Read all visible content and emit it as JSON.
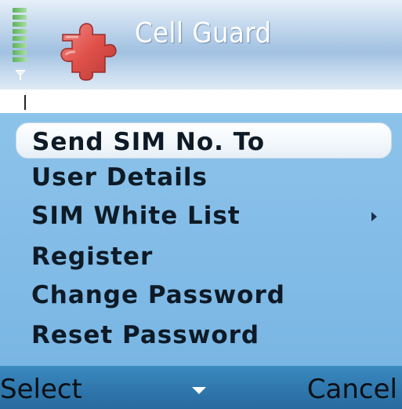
{
  "app": {
    "title": "Cell Guard",
    "icon": "puzzle-piece-icon"
  },
  "status": {
    "signal_icon": "antenna-icon",
    "signal_bars": 8
  },
  "menu": {
    "items": [
      {
        "label": "Send SIM No. To",
        "selected": true
      },
      {
        "label": "User Details"
      },
      {
        "label": "SIM White List",
        "has_submenu": true
      },
      {
        "label": "Register"
      },
      {
        "label": "Change Password"
      },
      {
        "label": "Reset Password"
      }
    ]
  },
  "softkeys": {
    "left": "Select",
    "right": "Cancel",
    "center_icon": "scroll-down-indicator-icon"
  },
  "colors": {
    "menu_bg": "#7ab6e4",
    "softkey_bg": "#2f77ad",
    "selection_bg": "#ffffff",
    "text": "#0e1a26",
    "title_text": "#ffffff",
    "icon_red": "#d9534f"
  }
}
